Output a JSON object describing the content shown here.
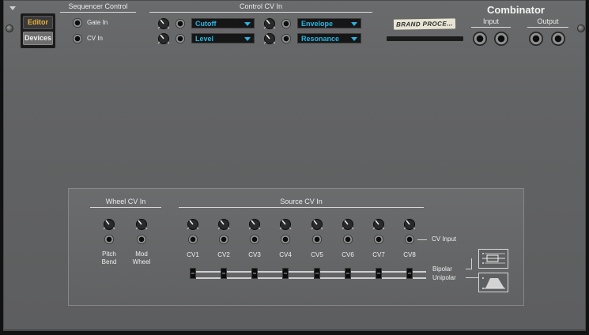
{
  "device": {
    "title": "Combinator",
    "tape_label": "BRAND PROCE..."
  },
  "tabs": {
    "editor": "Editor",
    "devices": "Devices"
  },
  "sequencer_control": {
    "title": "Sequencer Control",
    "gate_in": "Gate In",
    "cv_in": "CV In"
  },
  "control_cv_in": {
    "title": "Control CV In",
    "targets": [
      "Cutoff",
      "Level",
      "Envelope",
      "Resonance"
    ]
  },
  "audio_io": {
    "input": "Input",
    "output": "Output"
  },
  "wheel_cv_in": {
    "title": "Wheel CV In",
    "pitch_bend": "Pitch\nBend",
    "mod_wheel": "Mod\nWheel"
  },
  "source_cv_in": {
    "title": "Source CV In",
    "channels": [
      "CV1",
      "CV2",
      "CV3",
      "CV4",
      "CV5",
      "CV6",
      "CV7",
      "CV8"
    ],
    "cv_input": "CV Input",
    "bipolar": "Bipolar",
    "unipolar": "Unipolar"
  },
  "colors": {
    "accent_editor": "#e9b43a",
    "dropdown_text": "#23b7e2"
  }
}
